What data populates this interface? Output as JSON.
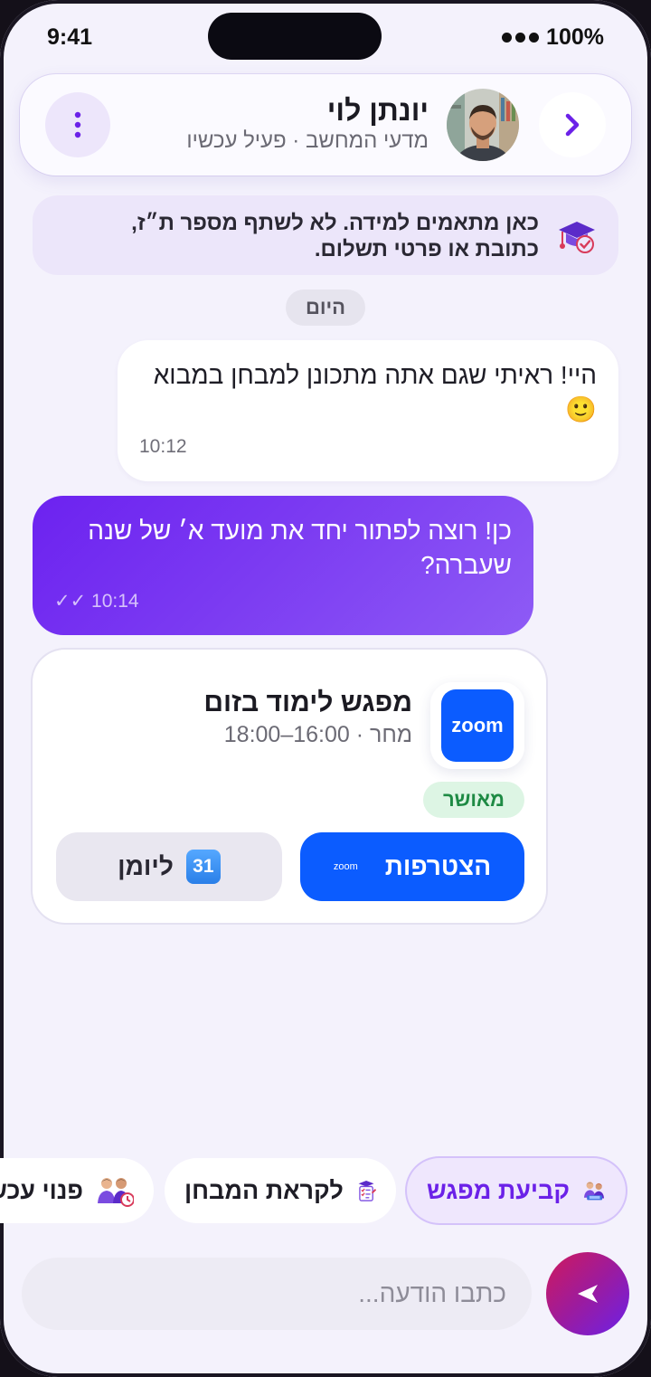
{
  "status_bar": {
    "time": "9:41",
    "battery": "100%"
  },
  "header": {
    "contact_name": "יונתן לוי",
    "contact_subtitle": "מדעי המחשב · פעיל עכשיו",
    "back_icon": "chevron-icon",
    "menu_icon": "vertical-dots-icon"
  },
  "notice": {
    "text": "כאן מתאמים למידה. לא לשתף מספר ת״ז, כתובת או פרטי תשלום.",
    "icon": "graduation-cap-icon"
  },
  "day_divider": "היום",
  "messages": [
    {
      "direction": "incoming",
      "text": "היי! ראיתי שגם אתה מתכונן למבחן במבוא 🙂",
      "time": "10:12"
    },
    {
      "direction": "outgoing",
      "text": "כן! רוצה לפתור יחד את מועד א׳ של שנה שעברה?",
      "time": "10:14",
      "receipt": "✓✓"
    }
  ],
  "event_card": {
    "logo_text": "zoom",
    "title": "מפגש לימוד בזום",
    "time": "מחר · 16:00–18:00",
    "status": "מאושר",
    "join_label": "הצטרפות",
    "join_logo": "zoom",
    "calendar_label": "ליומן",
    "calendar_day": "31"
  },
  "quick_replies": [
    {
      "label": "קביעת מפגש",
      "icon": "study-group-icon",
      "active": true
    },
    {
      "label": "לקראת המבחן",
      "icon": "exam-checklist-icon",
      "active": false
    },
    {
      "label": "פנוי עכשיו",
      "icon": "people-clock-icon",
      "active": false
    }
  ],
  "composer": {
    "placeholder": "כתבו הודעה...",
    "send_icon": "send-arrow-icon"
  },
  "colors": {
    "accent": "#6B21E8",
    "outgoing_bubble": "#7B3AF2",
    "zoom_blue": "#0B5CFF",
    "confirmed_green": "#1E8A44",
    "background": "#F4F2FC"
  }
}
